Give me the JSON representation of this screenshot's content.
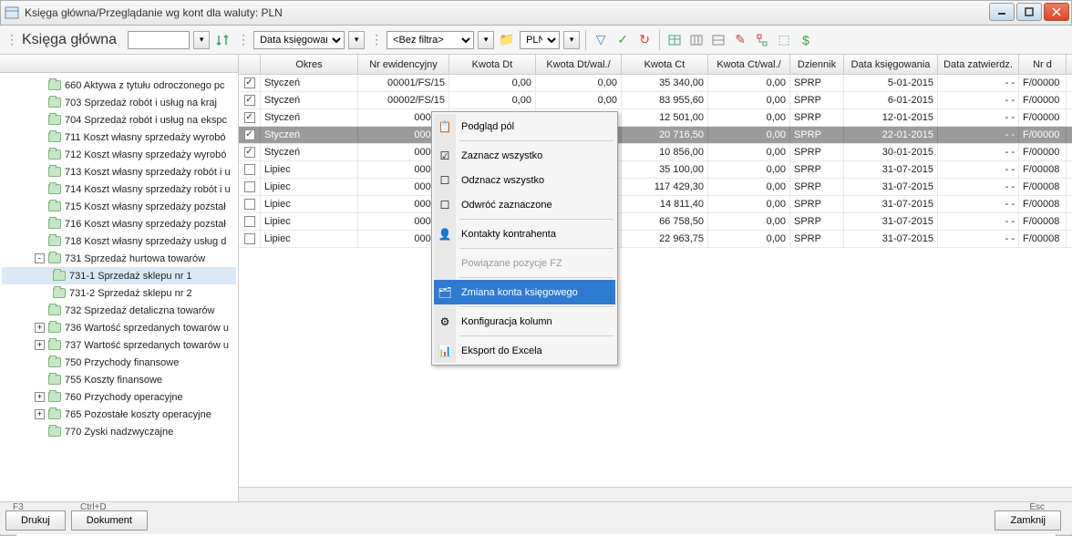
{
  "window": {
    "title": "Księga główna/Przeglądanie wg kont dla waluty: PLN"
  },
  "toolbar": {
    "title": "Księga główna",
    "date_select": "Data księgowania",
    "filter_select": "<Bez filtra>",
    "currency_select": "PLN"
  },
  "tree": [
    {
      "lv": 1,
      "exp": "",
      "id": "660",
      "label": "Aktywa z tytułu odroczonego pc"
    },
    {
      "lv": 1,
      "exp": "",
      "id": "703",
      "label": "Sprzedaż robót i usług na kraj"
    },
    {
      "lv": 1,
      "exp": "",
      "id": "704",
      "label": "Sprzedaż robót i usług na ekspc"
    },
    {
      "lv": 1,
      "exp": "",
      "id": "711",
      "label": "Koszt własny sprzedaży wyrobó"
    },
    {
      "lv": 1,
      "exp": "",
      "id": "712",
      "label": "Koszt własny sprzedaży wyrobó"
    },
    {
      "lv": 1,
      "exp": "",
      "id": "713",
      "label": "Koszt własny sprzedaży robót i u"
    },
    {
      "lv": 1,
      "exp": "",
      "id": "714",
      "label": "Koszt własny sprzedaży robót i u"
    },
    {
      "lv": 1,
      "exp": "",
      "id": "715",
      "label": "Koszt własny sprzedaży pozstał"
    },
    {
      "lv": 1,
      "exp": "",
      "id": "716",
      "label": "Koszt własny sprzedaży pozstał"
    },
    {
      "lv": 1,
      "exp": "",
      "id": "718",
      "label": "Koszt własny sprzedaży usług d"
    },
    {
      "lv": 1,
      "exp": "-",
      "id": "731",
      "label": "Sprzedaż hurtowa towarów"
    },
    {
      "lv": 2,
      "exp": "",
      "id": "731-1",
      "label": "Sprzedaż sklepu nr 1",
      "sel": true
    },
    {
      "lv": 2,
      "exp": "",
      "id": "731-2",
      "label": "Sprzedaż sklepu nr 2"
    },
    {
      "lv": 1,
      "exp": "",
      "id": "732",
      "label": "Sprzedaż detaliczna towarów"
    },
    {
      "lv": 1,
      "exp": "+",
      "id": "736",
      "label": "Wartość sprzedanych towarów u"
    },
    {
      "lv": 1,
      "exp": "+",
      "id": "737",
      "label": "Wartość sprzedanych towarów u"
    },
    {
      "lv": 1,
      "exp": "",
      "id": "750",
      "label": "Przychody finansowe"
    },
    {
      "lv": 1,
      "exp": "",
      "id": "755",
      "label": "Koszty finansowe"
    },
    {
      "lv": 1,
      "exp": "+",
      "id": "760",
      "label": "Przychody operacyjne"
    },
    {
      "lv": 1,
      "exp": "+",
      "id": "765",
      "label": "Pozostałe koszty operacyjne"
    },
    {
      "lv": 1,
      "exp": "",
      "id": "770",
      "label": "Zyski nadzwyczajne"
    }
  ],
  "grid": {
    "headers": {
      "chk": "",
      "okres": "Okres",
      "nrew": "Nr ewidencyjny",
      "kwdt": "Kwota Dt",
      "kwdtw": "Kwota Dt/wal./",
      "kwct": "Kwota Ct",
      "kwctw": "Kwota Ct/wal./",
      "dz": "Dziennik",
      "dk": "Data księgowania",
      "dzat": "Data zatwierdz.",
      "nrd": "Nr d"
    },
    "rows": [
      {
        "chk": true,
        "okres": "Styczeń",
        "nrew": "00001/FS/15",
        "kwdt": "0,00",
        "kwdtw": "0,00",
        "kwct": "35 340,00",
        "kwctw": "0,00",
        "dz": "SPRP",
        "dk": "5-01-2015",
        "dzat": "- -",
        "nrd": "F/00000"
      },
      {
        "chk": true,
        "okres": "Styczeń",
        "nrew": "00002/FS/15",
        "kwdt": "0,00",
        "kwdtw": "0,00",
        "kwct": "83 955,60",
        "kwctw": "0,00",
        "dz": "SPRP",
        "dk": "6-01-2015",
        "dzat": "- -",
        "nrd": "F/00000"
      },
      {
        "chk": true,
        "okres": "Styczeń",
        "nrew": "00004/",
        "kwdt": "",
        "kwdtw": "00",
        "kwct": "12 501,00",
        "kwctw": "0,00",
        "dz": "SPRP",
        "dk": "12-01-2015",
        "dzat": "- -",
        "nrd": "F/00000"
      },
      {
        "chk": true,
        "okres": "Styczeń",
        "nrew": "00007/",
        "kwdt": "",
        "kwdtw": "00",
        "kwct": "20 716,50",
        "kwctw": "0,00",
        "dz": "SPRP",
        "dk": "22-01-2015",
        "dzat": "- -",
        "nrd": "F/00000",
        "sel": true
      },
      {
        "chk": true,
        "okres": "Styczeń",
        "nrew": "00010/",
        "kwdt": "",
        "kwdtw": "00",
        "kwct": "10 856,00",
        "kwctw": "0,00",
        "dz": "SPRP",
        "dk": "30-01-2015",
        "dzat": "- -",
        "nrd": "F/00000"
      },
      {
        "chk": false,
        "okres": "Lipiec",
        "nrew": "00023/",
        "kwdt": "",
        "kwdtw": "00",
        "kwct": "35 100,00",
        "kwctw": "0,00",
        "dz": "SPRP",
        "dk": "31-07-2015",
        "dzat": "- -",
        "nrd": "F/00008"
      },
      {
        "chk": false,
        "okres": "Lipiec",
        "nrew": "00024/",
        "kwdt": "",
        "kwdtw": "00",
        "kwct": "117 429,30",
        "kwctw": "0,00",
        "dz": "SPRP",
        "dk": "31-07-2015",
        "dzat": "- -",
        "nrd": "F/00008"
      },
      {
        "chk": false,
        "okres": "Lipiec",
        "nrew": "00026/",
        "kwdt": "",
        "kwdtw": "00",
        "kwct": "14 811,40",
        "kwctw": "0,00",
        "dz": "SPRP",
        "dk": "31-07-2015",
        "dzat": "- -",
        "nrd": "F/00008"
      },
      {
        "chk": false,
        "okres": "Lipiec",
        "nrew": "00029/",
        "kwdt": "",
        "kwdtw": "00",
        "kwct": "66 758,50",
        "kwctw": "0,00",
        "dz": "SPRP",
        "dk": "31-07-2015",
        "dzat": "- -",
        "nrd": "F/00008"
      },
      {
        "chk": false,
        "okres": "Lipiec",
        "nrew": "00032/",
        "kwdt": "",
        "kwdtw": "00",
        "kwct": "22 963,75",
        "kwctw": "0,00",
        "dz": "SPRP",
        "dk": "31-07-2015",
        "dzat": "- -",
        "nrd": "F/00008"
      }
    ]
  },
  "context_menu": [
    {
      "label": "Podgląd pól",
      "icon": "📋"
    },
    {
      "sep": true
    },
    {
      "label": "Zaznacz wszystko",
      "icon": "☑"
    },
    {
      "label": "Odznacz wszystko",
      "icon": "☐"
    },
    {
      "label": "Odwróć zaznaczone",
      "icon": "☐"
    },
    {
      "sep": true
    },
    {
      "label": "Kontakty kontrahenta",
      "icon": "👤"
    },
    {
      "sep": true
    },
    {
      "label": "Powiązane pozycje FZ",
      "icon": "",
      "disabled": true
    },
    {
      "sep": true
    },
    {
      "label": "Zmiana konta księgowego",
      "icon": "🗂",
      "hl": true
    },
    {
      "sep": true
    },
    {
      "label": "Konfiguracja kolumn",
      "icon": "⚙"
    },
    {
      "sep": true
    },
    {
      "label": "Eksport do Excela",
      "icon": "📊"
    }
  ],
  "footer": {
    "f3": "F3",
    "ctrld": "Ctrl+D",
    "esc": "Esc",
    "print": "Drukuj",
    "document": "Dokument",
    "close": "Zamknij"
  }
}
